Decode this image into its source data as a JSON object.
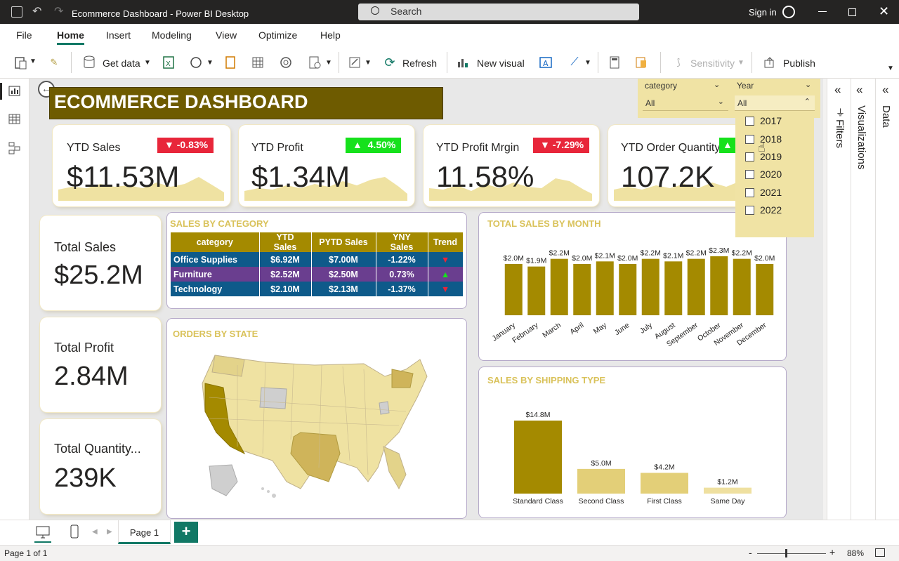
{
  "window": {
    "title": "Ecommerce Dashboard - Power BI Desktop",
    "search_placeholder": "Search",
    "sign_in": "Sign in"
  },
  "menu": [
    "File",
    "Home",
    "Insert",
    "Modeling",
    "View",
    "Optimize",
    "Help"
  ],
  "ribbon": {
    "get_data": "Get data",
    "refresh": "Refresh",
    "new_visual": "New visual",
    "sensitivity": "Sensitivity",
    "publish": "Publish"
  },
  "dashboard": {
    "title": "ECOMMERCE DASHBOARD"
  },
  "kpis": [
    {
      "label": "YTD Sales",
      "value": "$11.53M",
      "change": "-0.83%",
      "direction": "down"
    },
    {
      "label": "YTD Profit",
      "value": "$1.34M",
      "change": "4.50%",
      "direction": "up"
    },
    {
      "label": "YTD Profit Mrgin",
      "value": "11.58%",
      "change": "-7.29%",
      "direction": "down"
    },
    {
      "label": "YTD Order Quantity",
      "value": "107.2K",
      "change": "",
      "direction": "up"
    }
  ],
  "side_kpis": [
    {
      "label": "Total Sales",
      "value": "$25.2M"
    },
    {
      "label": "Total Profit",
      "value": "2.84M"
    },
    {
      "label": "Total Quantity...",
      "value": "239K"
    }
  ],
  "category_table": {
    "title": "SALES BY CATEGORY",
    "headers": [
      "category",
      "YTD Sales",
      "PYTD Sales",
      "YNY Sales",
      "Trend"
    ],
    "rows": [
      {
        "category": "Office Supplies",
        "ytd": "$6.92M",
        "pytd": "$7.00M",
        "yny": "-1.22%",
        "trend": "down"
      },
      {
        "category": "Furniture",
        "ytd": "$2.52M",
        "pytd": "$2.50M",
        "yny": "0.73%",
        "trend": "up"
      },
      {
        "category": "Technology",
        "ytd": "$2.10M",
        "pytd": "$2.13M",
        "yny": "-1.37%",
        "trend": "down"
      }
    ]
  },
  "map": {
    "title": "ORDERS BY STATE"
  },
  "slicers": {
    "category_label": "category",
    "category_value": "All",
    "year_label": "Year",
    "year_value": "All",
    "years": [
      "2017",
      "2018",
      "2019",
      "2020",
      "2021",
      "2022"
    ]
  },
  "panes": {
    "filters": "Filters",
    "visualizations": "Visualizations",
    "data": "Data"
  },
  "pages": {
    "tab": "Page 1",
    "add": "+"
  },
  "status": {
    "page": "Page 1 of 1",
    "zoom": "88%"
  },
  "colors": {
    "accent": "#a48a00",
    "light": "#f0e3a4",
    "title_bg": "#6e5b00",
    "red": "#e8263a",
    "green": "#16e11c"
  },
  "chart_data": [
    {
      "type": "bar",
      "title": "TOTAL SALES BY MONTH",
      "categories": [
        "January",
        "February",
        "March",
        "April",
        "May",
        "June",
        "July",
        "August",
        "September",
        "October",
        "November",
        "December"
      ],
      "values": [
        2.0,
        1.9,
        2.2,
        2.0,
        2.1,
        2.0,
        2.2,
        2.1,
        2.2,
        2.3,
        2.2,
        2.0
      ],
      "labels": [
        "$2.0M",
        "$1.9M",
        "$2.2M",
        "$2.0M",
        "$2.1M",
        "$2.0M",
        "$2.2M",
        "$2.1M",
        "$2.2M",
        "$2.3M",
        "$2.2M",
        "$2.0M"
      ],
      "ylim": [
        0,
        2.3
      ]
    },
    {
      "type": "bar",
      "title": "SALES BY SHIPPING TYPE",
      "categories": [
        "Standard Class",
        "Second Class",
        "First Class",
        "Same Day"
      ],
      "values": [
        14.8,
        5.0,
        4.2,
        1.2
      ],
      "labels": [
        "$14.8M",
        "$5.0M",
        "$4.2M",
        "$1.2M"
      ],
      "ylim": [
        0,
        14.8
      ]
    }
  ]
}
